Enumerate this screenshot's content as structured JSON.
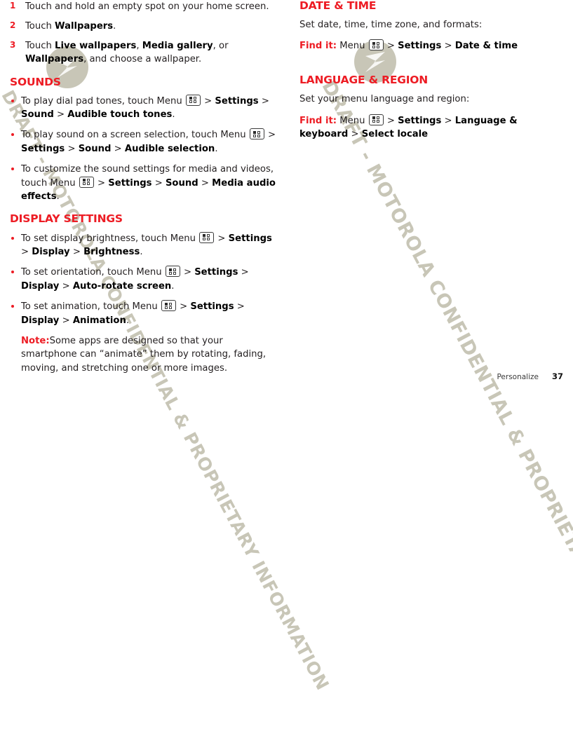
{
  "document": {
    "watermark_text": "DRAFT - MOTOROLA CONFIDENTIAL & PROPRIETARY INFORMATION",
    "logo_icon": "motorola-batwing-logo",
    "accent_color": "#ed1c24",
    "watermark_color": "#c8c6b7"
  },
  "left_column": {
    "steps": [
      {
        "number": "1",
        "parts": [
          {
            "text": "Touch and hold an empty spot on your home screen.",
            "bold": false
          }
        ]
      },
      {
        "number": "2",
        "parts": [
          {
            "text": "Touch ",
            "bold": false
          },
          {
            "text": "Wallpapers",
            "bold": true
          },
          {
            "text": ".",
            "bold": false
          }
        ]
      },
      {
        "number": "3",
        "parts": [
          {
            "text": "Touch ",
            "bold": false
          },
          {
            "text": "Live wallpapers",
            "bold": true
          },
          {
            "text": ", ",
            "bold": false
          },
          {
            "text": "Media gallery",
            "bold": true
          },
          {
            "text": ", or ",
            "bold": false
          },
          {
            "text": "Wallpapers",
            "bold": true
          },
          {
            "text": ", and choose a wallpaper.",
            "bold": false
          }
        ]
      }
    ],
    "sounds": {
      "heading": "SOUNDS",
      "bullets": [
        {
          "parts": [
            {
              "text": "To play dial pad tones, touch Menu ",
              "bold": false
            },
            {
              "icon": "menu-key-icon"
            },
            {
              "text": " > ",
              "bold": false
            },
            {
              "text": "Settings",
              "bold": true
            },
            {
              "text": " > ",
              "bold": false
            },
            {
              "text": "Sound",
              "bold": true
            },
            {
              "text": " > ",
              "bold": false
            },
            {
              "text": "Audible touch tones",
              "bold": true
            },
            {
              "text": ".",
              "bold": false
            }
          ]
        },
        {
          "parts": [
            {
              "text": "To play sound on a screen selection, touch Menu ",
              "bold": false
            },
            {
              "icon": "menu-key-icon"
            },
            {
              "text": " > ",
              "bold": false
            },
            {
              "text": "Settings",
              "bold": true
            },
            {
              "text": " > ",
              "bold": false
            },
            {
              "text": "Sound",
              "bold": true
            },
            {
              "text": " > ",
              "bold": false
            },
            {
              "text": "Audible selection",
              "bold": true
            },
            {
              "text": ".",
              "bold": false
            }
          ]
        },
        {
          "parts": [
            {
              "text": "To customize the sound settings for media and videos, touch Menu ",
              "bold": false
            },
            {
              "icon": "menu-key-icon"
            },
            {
              "text": " > ",
              "bold": false
            },
            {
              "text": "Settings",
              "bold": true
            },
            {
              "text": " > ",
              "bold": false
            },
            {
              "text": "Sound",
              "bold": true
            },
            {
              "text": " > ",
              "bold": false
            },
            {
              "text": "Media audio effects",
              "bold": true
            },
            {
              "text": ".",
              "bold": false
            }
          ]
        }
      ]
    },
    "display_settings": {
      "heading": "DISPLAY SETTINGS",
      "bullets": [
        {
          "parts": [
            {
              "text": "To set display brightness, touch Menu ",
              "bold": false
            },
            {
              "icon": "menu-key-icon"
            },
            {
              "text": " > ",
              "bold": false
            },
            {
              "text": "Settings",
              "bold": true
            },
            {
              "text": " > ",
              "bold": false
            },
            {
              "text": "Display",
              "bold": true
            },
            {
              "text": " > ",
              "bold": false
            },
            {
              "text": "Brightness",
              "bold": true
            },
            {
              "text": ".",
              "bold": false
            }
          ]
        },
        {
          "parts": [
            {
              "text": "To set orientation, touch Menu ",
              "bold": false
            },
            {
              "icon": "menu-key-icon"
            },
            {
              "text": " > ",
              "bold": false
            },
            {
              "text": "Settings",
              "bold": true
            },
            {
              "text": " > ",
              "bold": false
            },
            {
              "text": "Display",
              "bold": true
            },
            {
              "text": " > ",
              "bold": false
            },
            {
              "text": "Auto-rotate screen",
              "bold": true
            },
            {
              "text": ".",
              "bold": false
            }
          ]
        },
        {
          "parts": [
            {
              "text": "To set animation, touch Menu ",
              "bold": false
            },
            {
              "icon": "menu-key-icon"
            },
            {
              "text": " > ",
              "bold": false
            },
            {
              "text": "Settings",
              "bold": true
            },
            {
              "text": " > ",
              "bold": false
            },
            {
              "text": "Display",
              "bold": true
            },
            {
              "text": " > ",
              "bold": false
            },
            {
              "text": "Animation",
              "bold": true
            },
            {
              "text": ".",
              "bold": false
            }
          ]
        }
      ],
      "note": {
        "label": "Note:",
        "text": "Some apps are designed so that your smartphone can “animate” them by rotating, fading, moving, and stretching one or more images."
      }
    }
  },
  "right_column": {
    "date_time": {
      "heading": "DATE & TIME",
      "intro": "Set date, time, time zone, and formats:",
      "find_it": {
        "label": "Find it:",
        "parts": [
          {
            "text": " Menu ",
            "bold": false
          },
          {
            "icon": "menu-key-icon"
          },
          {
            "text": " > ",
            "bold": false
          },
          {
            "text": "Settings",
            "bold": true
          },
          {
            "text": " > ",
            "bold": false
          },
          {
            "text": "Date & time",
            "bold": true
          }
        ]
      }
    },
    "language_region": {
      "heading": "LANGUAGE & REGION",
      "intro": "Set your menu language and region:",
      "find_it": {
        "label": "Find it:",
        "parts": [
          {
            "text": " Menu ",
            "bold": false
          },
          {
            "icon": "menu-key-icon"
          },
          {
            "text": " > ",
            "bold": false
          },
          {
            "text": "Settings",
            "bold": true
          },
          {
            "text": " > ",
            "bold": false
          },
          {
            "text": "Language & keyboard",
            "bold": true
          },
          {
            "text": " > ",
            "bold": false
          },
          {
            "text": "Select locale",
            "bold": true
          }
        ]
      }
    }
  },
  "footer": {
    "chapter": "Personalize",
    "page_number": "37"
  }
}
